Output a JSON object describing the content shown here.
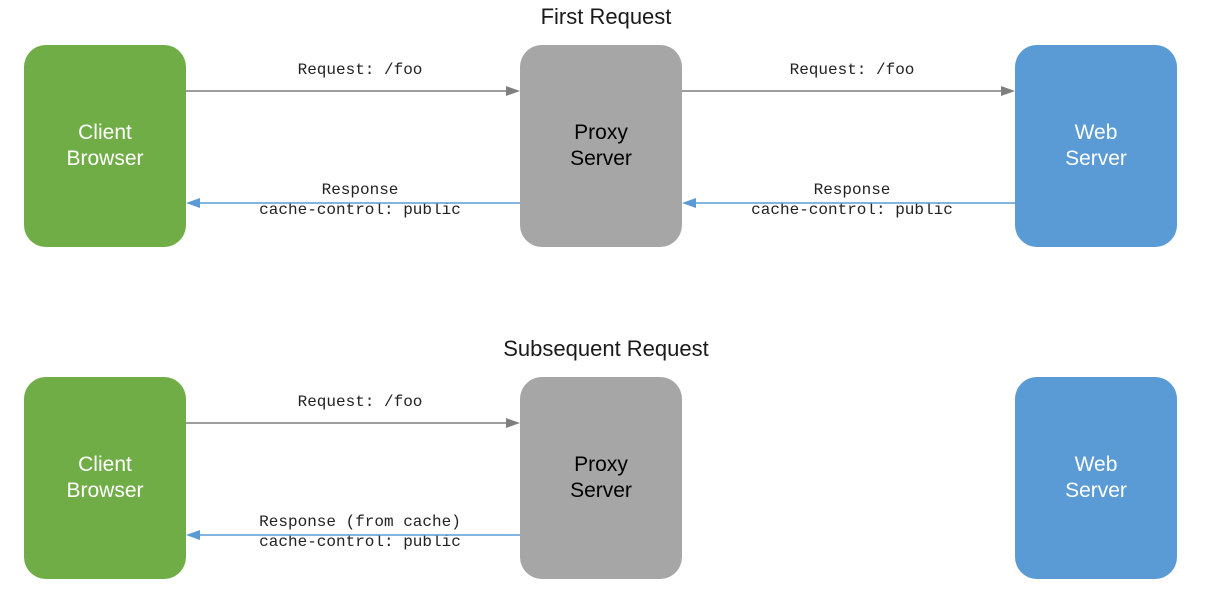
{
  "sections": {
    "first": {
      "title": "First Request"
    },
    "subsequent": {
      "title": "Subsequent Request"
    }
  },
  "nodes": {
    "first": {
      "client": {
        "line1": "Client",
        "line2": "Browser"
      },
      "proxy": {
        "line1": "Proxy",
        "line2": "Server"
      },
      "web": {
        "line1": "Web",
        "line2": "Server"
      }
    },
    "subsequent": {
      "client": {
        "line1": "Client",
        "line2": "Browser"
      },
      "proxy": {
        "line1": "Proxy",
        "line2": "Server"
      },
      "web": {
        "line1": "Web",
        "line2": "Server"
      }
    }
  },
  "arrows": {
    "first": {
      "req_client_proxy": {
        "label": "Request: /foo"
      },
      "req_proxy_web": {
        "label": "Request: /foo"
      },
      "resp_web_proxy": {
        "line1": "Response",
        "line2": "cache-control: public"
      },
      "resp_proxy_client": {
        "line1": "Response",
        "line2": "cache-control: public"
      }
    },
    "subsequent": {
      "req_client_proxy": {
        "label": "Request: /foo"
      },
      "resp_proxy_client": {
        "line1": "Response (from cache)",
        "line2": "cache-control: public"
      }
    }
  }
}
